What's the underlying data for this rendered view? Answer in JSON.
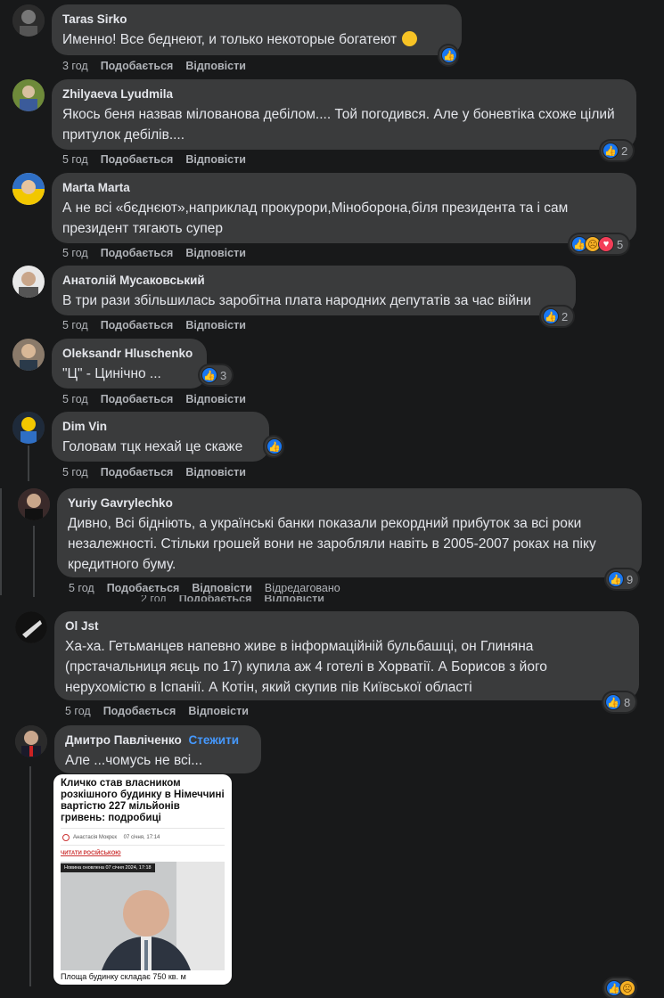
{
  "labels": {
    "like": "Подобається",
    "reply": "Відповісти",
    "edited": "Відредаговано",
    "follow": "Стежити"
  },
  "comments": [
    {
      "author": "Taras Sirko",
      "text": "Именно! Все беднеют, и только некоторые богатеют",
      "time": "3 год"
    },
    {
      "author": "Zhilyaeva Lyudmila",
      "text": "Якось беня назвав мілованова дебілом.... Той погодився. Але у боневтіка схоже цілий притулок дебілів....",
      "time": "5 год",
      "reactions": "2"
    },
    {
      "author": "Marta Marta",
      "text": "А не всі «бєднєют»,наприклад прокурори,Міноборона,біля президента та і сам президент тягають супер",
      "time": "5 год",
      "reactions": "5"
    },
    {
      "author": "Анатолій Мусаковський",
      "text": "В три рази збільшилась заробітна плата народних депутатів за час війни",
      "time": "5 год",
      "reactions": "2"
    },
    {
      "author": "Oleksandr Hluschenko",
      "text": "\"Ц\" - Цинічно ...",
      "time": "5 год",
      "reactions": "3"
    },
    {
      "author": "Dim Vin",
      "text": "Головам тцк нехай це скаже",
      "time": "5 год"
    },
    {
      "author": "Yuriy Gavrylechko",
      "text": "Дивно, Всі бідніють, а українські банки показали рекордний прибуток за всі роки незалежності. Стільки грошей вони не заробляли навіть в 2005-2007 роках на піку кредитного буму.",
      "time": "5 год",
      "reactions": "9"
    },
    {
      "author": "Ol Jst",
      "text": "Ха-ха. Гетьманцев напевно живе в інформаційній бульбашці, он Глиняна (прстачальниця яєць по 17) купила аж 4 готелі в Хорватії. А Борисов з його нерухомістю в Іспанії. А Котін, який скупив пів Київської області",
      "time": "5 год",
      "reactions": "8"
    },
    {
      "author": "Дмитро Павліченко",
      "text": "Але ...чомусь не всі...",
      "time": ""
    }
  ],
  "ghost": {
    "time": "2 год",
    "like": "Подобається",
    "reply": "Відповісти"
  },
  "news_card": {
    "title": "Кличко став власником розкішного будинку в Німеччині вартістю 227 мільйонів гривень: подробиці",
    "author": "Анастасія Мокрєк",
    "date": "07 січня, 17:14",
    "read_link": "ЧИТАТИ РОСІЙСЬКОЮ",
    "badge": "Новина оновлена 07 січня 2024, 17:18",
    "caption": "Площа будинку складає 750 кв. м"
  }
}
